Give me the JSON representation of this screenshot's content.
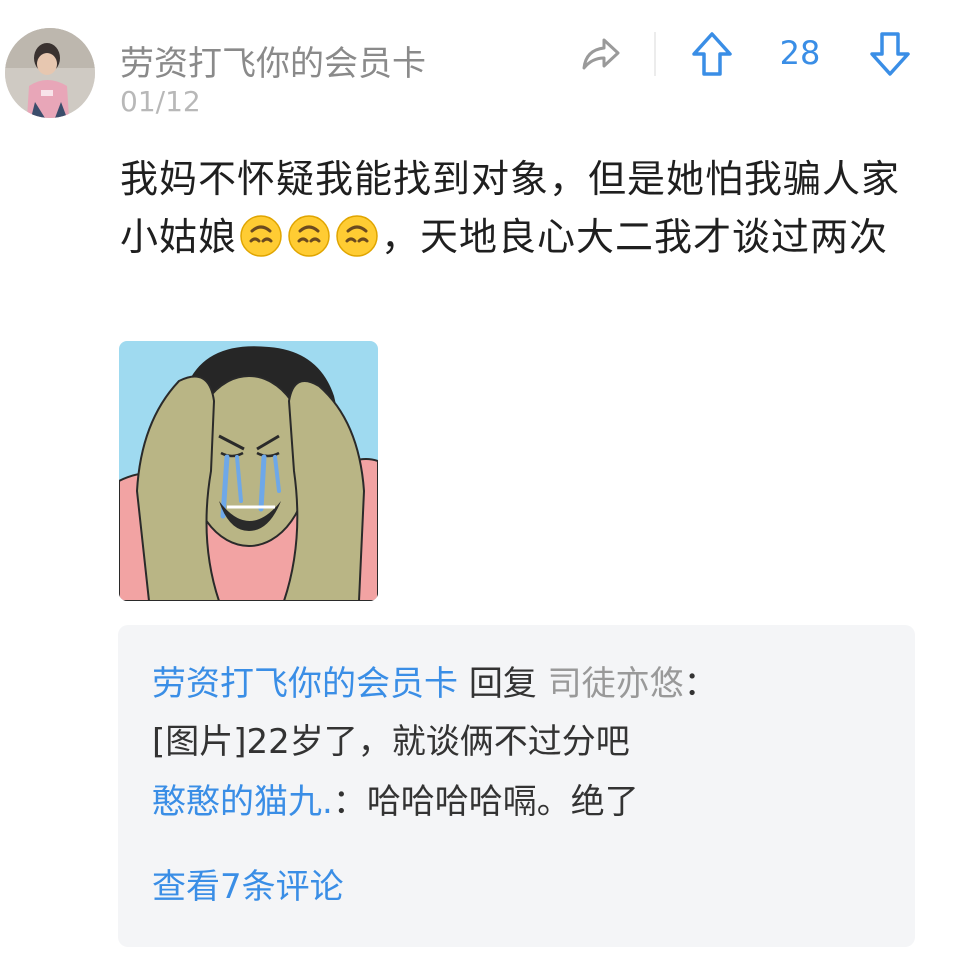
{
  "post": {
    "username": "劳资打飞你的会员卡",
    "date": "01/12",
    "vote_count": "28",
    "content": {
      "line_before_emoji": "我妈不怀疑我能找到对象，但是她怕我骗人家小姑娘",
      "line_after_emoji": "，天地良心大二我才谈过两次",
      "emojis": [
        "upside-down-face",
        "upside-down-face",
        "upside-down-face"
      ]
    }
  },
  "comments": {
    "items": [
      {
        "author": "劳资打飞你的会员卡",
        "reply_word": "回复",
        "reply_to": "司徒亦悠",
        "separator": "：",
        "text": "[图片]22岁了，就谈俩不过分吧"
      },
      {
        "author": "憨憨的猫九.",
        "separator": "：",
        "text": "哈哈哈哈嗝。绝了"
      }
    ],
    "view_all": "查看7条评论"
  },
  "colors": {
    "accent": "#3a8ee6",
    "username": "#8a8a8a",
    "date": "#b8b8b8",
    "comment_bg": "#f4f5f7"
  },
  "icons": [
    "share-icon",
    "upvote-icon",
    "downvote-icon"
  ]
}
